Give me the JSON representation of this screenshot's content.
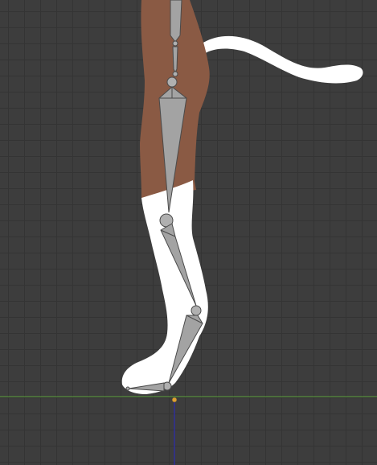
{
  "viewport": {
    "background_color": "#3d3d3d",
    "grid_color": "#343434",
    "x_axis_color": "#5a9e3a",
    "z_axis_color": "#2e2e9a",
    "origin_color": "#e0a030"
  },
  "model": {
    "skin_color": "#8a5a44",
    "sock_color": "#ffffff",
    "bone_fill": "#a3a3a3",
    "bone_stroke": "#4a4a4a",
    "joint_fill": "#b0b0b0"
  }
}
